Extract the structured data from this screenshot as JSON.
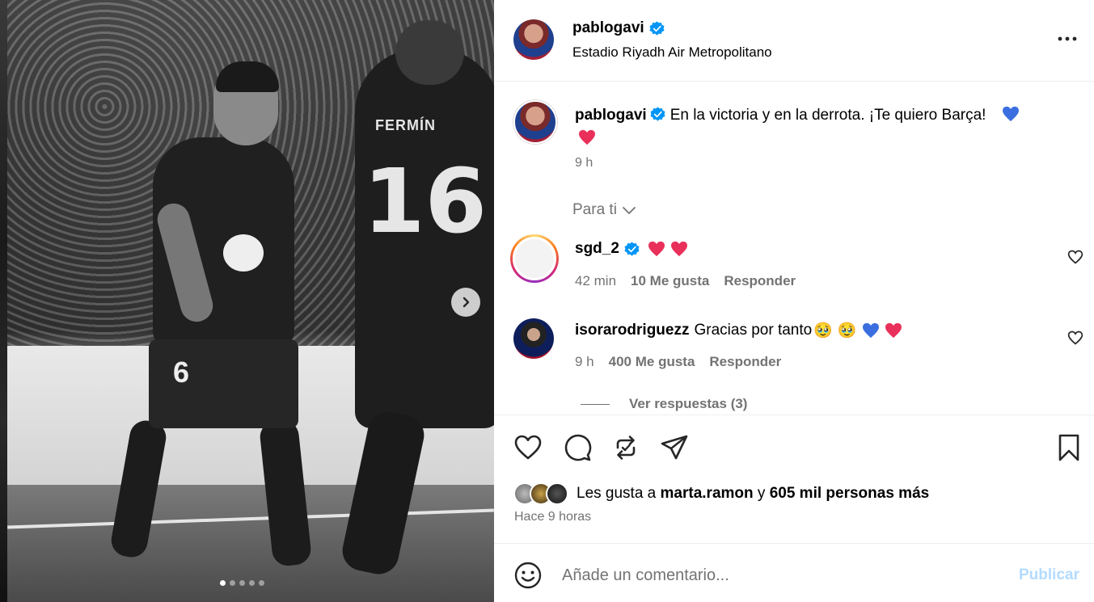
{
  "post": {
    "username": "pablogavi",
    "location": "Estadio Riyadh Air Metropolitano",
    "caption_text": "En la victoria y en la derrota. ¡Te quiero Barça!",
    "caption_time": "9 h",
    "jersey_name": "FERMÍN",
    "jersey_number": "16",
    "shorts_number": "6",
    "carousel_count": 5,
    "carousel_active": 0
  },
  "filter": {
    "label": "Para ti"
  },
  "comments": [
    {
      "username": "sgd_2",
      "verified": true,
      "text": "",
      "time": "42 min",
      "likes": "10 Me gusta",
      "reply": "Responder"
    },
    {
      "username": "isorarodriguezz",
      "verified": false,
      "text": "Gracias por tanto",
      "time": "9 h",
      "likes": "400 Me gusta",
      "reply": "Responder"
    }
  ],
  "replies": {
    "label": "Ver respuestas (3)"
  },
  "likes": {
    "prefix": "Les gusta a",
    "user": "marta.ramon",
    "joiner": "y",
    "others": "605 mil personas más"
  },
  "posted_ago": "Hace 9 horas",
  "compose": {
    "placeholder": "Añade un comentario...",
    "publish_label": "Publicar"
  },
  "colors": {
    "verified": "#0095f6",
    "publish_disabled": "#b3dbff",
    "muted": "#737373",
    "heart_red": "#ff3040",
    "heart_blue": "#3b82f6"
  }
}
